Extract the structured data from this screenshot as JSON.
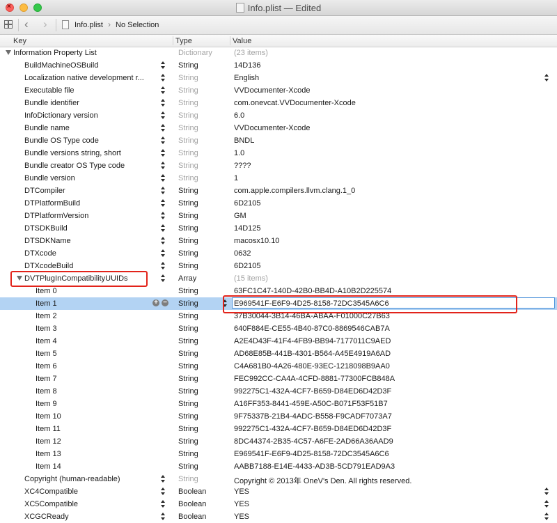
{
  "window": {
    "title": "Info.plist — Edited"
  },
  "jumpbar": {
    "filename": "Info.plist",
    "selection": "No Selection"
  },
  "columns": {
    "key": "Key",
    "type": "Type",
    "value": "Value"
  },
  "root": {
    "key": "Information Property List",
    "type": "Dictionary",
    "value": "(23 items)"
  },
  "rows": [
    {
      "key": "BuildMachineOSBuild",
      "type": "String",
      "value": "14D136",
      "dimType": false
    },
    {
      "key": "Localization native development r...",
      "type": "String",
      "value": "English",
      "dimType": true,
      "valuePopup": true
    },
    {
      "key": "Executable file",
      "type": "String",
      "value": "VVDocumenter-Xcode",
      "dimType": true
    },
    {
      "key": "Bundle identifier",
      "type": "String",
      "value": "com.onevcat.VVDocumenter-Xcode",
      "dimType": true
    },
    {
      "key": "InfoDictionary version",
      "type": "String",
      "value": "6.0",
      "dimType": true
    },
    {
      "key": "Bundle name",
      "type": "String",
      "value": "VVDocumenter-Xcode",
      "dimType": true
    },
    {
      "key": "Bundle OS Type code",
      "type": "String",
      "value": "BNDL",
      "dimType": true
    },
    {
      "key": "Bundle versions string, short",
      "type": "String",
      "value": "1.0",
      "dimType": true
    },
    {
      "key": "Bundle creator OS Type code",
      "type": "String",
      "value": "????",
      "dimType": true
    },
    {
      "key": "Bundle version",
      "type": "String",
      "value": "1",
      "dimType": true
    },
    {
      "key": "DTCompiler",
      "type": "String",
      "value": "com.apple.compilers.llvm.clang.1_0",
      "dimType": false
    },
    {
      "key": "DTPlatformBuild",
      "type": "String",
      "value": "6D2105",
      "dimType": false
    },
    {
      "key": "DTPlatformVersion",
      "type": "String",
      "value": "GM",
      "dimType": false
    },
    {
      "key": "DTSDKBuild",
      "type": "String",
      "value": "14D125",
      "dimType": false
    },
    {
      "key": "DTSDKName",
      "type": "String",
      "value": "macosx10.10",
      "dimType": false
    },
    {
      "key": "DTXcode",
      "type": "String",
      "value": "0632",
      "dimType": false
    },
    {
      "key": "DTXcodeBuild",
      "type": "String",
      "value": "6D2105",
      "dimType": false
    }
  ],
  "array": {
    "key": "DVTPlugInCompatibilityUUIDs",
    "type": "Array",
    "value": "(15 items)"
  },
  "items": [
    {
      "key": "Item 0",
      "type": "String",
      "value": "63FC1C47-140D-42B0-BB4D-A10B2D225574"
    },
    {
      "key": "Item 1",
      "type": "String",
      "value": "E969541F-E6F9-4D25-8158-72DC3545A6C6",
      "selected": true
    },
    {
      "key": "Item 2",
      "type": "String",
      "value": "37B30044-3B14-46BA-ABAA-F01000C27B63"
    },
    {
      "key": "Item 3",
      "type": "String",
      "value": "640F884E-CE55-4B40-87C0-8869546CAB7A"
    },
    {
      "key": "Item 4",
      "type": "String",
      "value": "A2E4D43F-41F4-4FB9-BB94-7177011C9AED"
    },
    {
      "key": "Item 5",
      "type": "String",
      "value": "AD68E85B-441B-4301-B564-A45E4919A6AD"
    },
    {
      "key": "Item 6",
      "type": "String",
      "value": "C4A681B0-4A26-480E-93EC-1218098B9AA0"
    },
    {
      "key": "Item 7",
      "type": "String",
      "value": "FEC992CC-CA4A-4CFD-8881-77300FCB848A"
    },
    {
      "key": "Item 8",
      "type": "String",
      "value": "992275C1-432A-4CF7-B659-D84ED6D42D3F"
    },
    {
      "key": "Item 9",
      "type": "String",
      "value": "A16FF353-8441-459E-A50C-B071F53F51B7"
    },
    {
      "key": "Item 10",
      "type": "String",
      "value": "9F75337B-21B4-4ADC-B558-F9CADF7073A7"
    },
    {
      "key": "Item 11",
      "type": "String",
      "value": "992275C1-432A-4CF7-B659-D84ED6D42D3F"
    },
    {
      "key": "Item 12",
      "type": "String",
      "value": "8DC44374-2B35-4C57-A6FE-2AD66A36AAD9"
    },
    {
      "key": "Item 13",
      "type": "String",
      "value": "E969541F-E6F9-4D25-8158-72DC3545A6C6"
    },
    {
      "key": "Item 14",
      "type": "String",
      "value": "AABB7188-E14E-4433-AD3B-5CD791EAD9A3"
    }
  ],
  "tail": [
    {
      "key": "Copyright (human-readable)",
      "type": "String",
      "value": "Copyright © 2013年 OneV's Den. All rights reserved.",
      "dimType": true
    },
    {
      "key": "XC4Compatible",
      "type": "Boolean",
      "value": "YES",
      "dimType": false,
      "valuePopup": true
    },
    {
      "key": "XC5Compatible",
      "type": "Boolean",
      "value": "YES",
      "dimType": false,
      "valuePopup": true
    },
    {
      "key": "XCGCReady",
      "type": "Boolean",
      "value": "YES",
      "dimType": false,
      "valuePopup": true
    }
  ],
  "colors": {
    "selection": "#b3d3f3",
    "highlight": "#e2231a",
    "focus": "#4a90d9"
  }
}
